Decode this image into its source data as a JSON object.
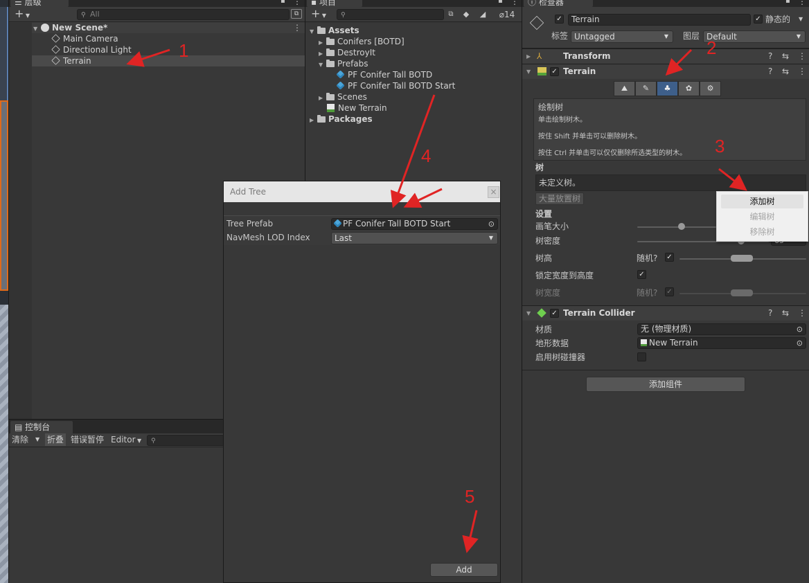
{
  "hierarchy": {
    "tab": "层级",
    "search_placeholder": "All",
    "add_symbol": "+",
    "scene": "New Scene*",
    "items": [
      "Main Camera",
      "Directional Light",
      "Terrain"
    ]
  },
  "project": {
    "tab": "项目",
    "add_symbol": "+",
    "badge_count": "14",
    "tree": {
      "assets": "Assets",
      "conifers": "Conifers [BOTD]",
      "destroyit": "DestroyIt",
      "prefabs": "Prefabs",
      "prefab_items": [
        "PF Conifer Tall BOTD",
        "PF Conifer Tall BOTD Start"
      ],
      "scenes": "Scenes",
      "new_terrain": "New Terrain",
      "packages": "Packages"
    }
  },
  "console": {
    "tab": "控制台",
    "clear": "清除",
    "collapse": "折叠",
    "error_pause": "错误暂停",
    "editor": "Editor"
  },
  "add_tree_dialog": {
    "title": "Add Tree",
    "close_symbol": "×",
    "tree_prefab_label": "Tree Prefab",
    "tree_prefab_value": "PF Conifer Tall BOTD Start",
    "navmesh_label": "NavMesh LOD Index",
    "navmesh_value": "Last",
    "add_button": "Add"
  },
  "inspector": {
    "tab": "检查器",
    "object_name": "Terrain",
    "static_label": "静态的",
    "tag_label": "标签",
    "tag_value": "Untagged",
    "layer_label": "图层",
    "layer_value": "Default",
    "transform": "Transform",
    "terrain": "Terrain",
    "paint_trees_title": "绘制树",
    "help_lines": [
      "单击绘制树木。",
      "按住 Shift 并单击可以删除树木。",
      "按住 Ctrl 并单击可以仅仅删除所选类型的树木。"
    ],
    "trees_header": "树",
    "no_trees": "未定义树。",
    "mass_place": "大量放置树",
    "settings_header": "设置",
    "brush_size": "画笔大小",
    "tree_density": "树密度",
    "tree_density_value": "65",
    "tree_height": "树高",
    "random_label": "随机?",
    "lock_width": "锁定宽度到高度",
    "tree_width": "树宽度",
    "collider_title": "Terrain Collider",
    "material_label": "材质",
    "material_value": "无 (物理材质)",
    "terrain_data_label": "地形数据",
    "terrain_data_value": "New Terrain",
    "enable_tree_colliders": "启用树碰撞器",
    "add_component": "添加组件"
  },
  "context_menu": {
    "items": [
      "添加树",
      "编辑树",
      "移除树"
    ]
  },
  "annotations": [
    "1",
    "2",
    "3",
    "4",
    "5"
  ],
  "colors": {
    "annotation": "#e02424",
    "selected_tool": "#3e5f8a",
    "prefab_blue": "#4ba5d9"
  }
}
